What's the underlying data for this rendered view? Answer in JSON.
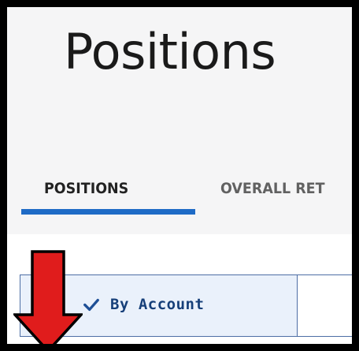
{
  "page": {
    "title": "Positions"
  },
  "tabs": [
    {
      "label": "POSITIONS",
      "active": true
    },
    {
      "label": "OVERALL RET",
      "active": false
    }
  ],
  "view_toggle": {
    "selected_label": "By Account"
  },
  "colors": {
    "accent": "#1e6bc6",
    "toggle_border": "#4d6ea5",
    "toggle_selected_bg": "#eaf1fb",
    "toggle_text": "#163f79",
    "annotation_arrow": "#e01c1c"
  },
  "icons": {
    "check": "check-icon",
    "annotation": "red-down-arrow"
  }
}
